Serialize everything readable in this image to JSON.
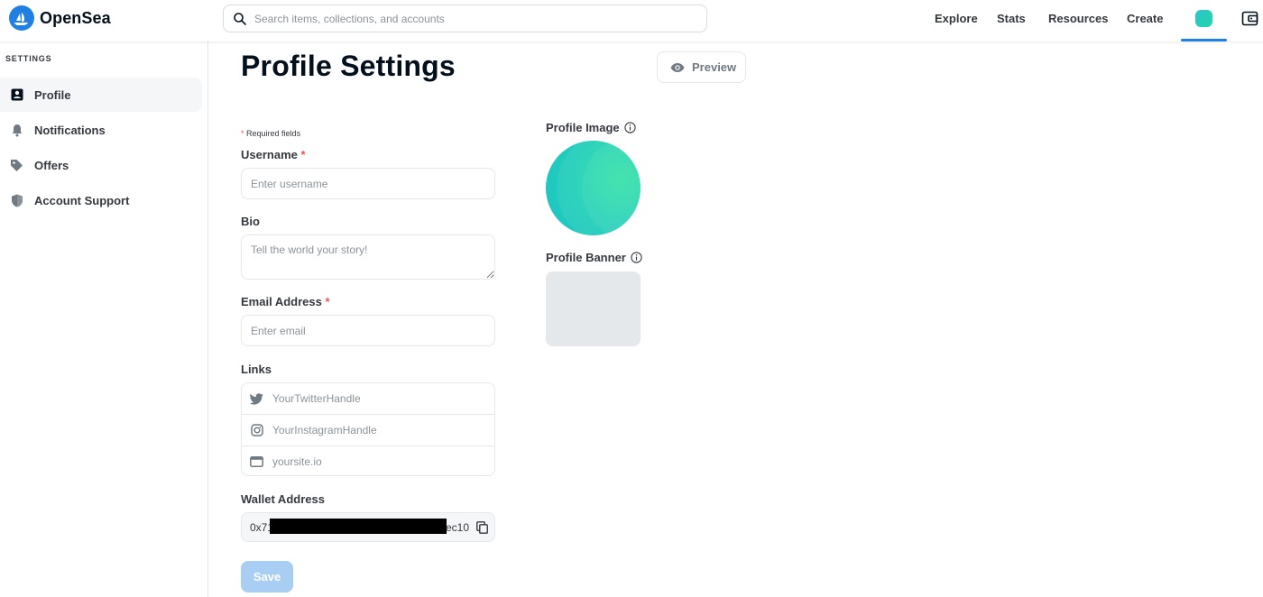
{
  "brand": {
    "name": "OpenSea",
    "logo_icon": "opensea-logo-icon",
    "color": "#2081e2"
  },
  "search": {
    "placeholder": "Search items, collections, and accounts",
    "icon": "search-icon"
  },
  "nav": {
    "links": [
      {
        "label": "Explore"
      },
      {
        "label": "Stats"
      },
      {
        "label": "Resources"
      },
      {
        "label": "Create"
      }
    ],
    "profile_icon": "user-avatar-icon",
    "wallet_icon": "wallet-icon"
  },
  "sidebar": {
    "heading": "SETTINGS",
    "items": [
      {
        "label": "Profile",
        "icon": "profile-icon",
        "active": true
      },
      {
        "label": "Notifications",
        "icon": "bell-icon",
        "active": false
      },
      {
        "label": "Offers",
        "icon": "tag-icon",
        "active": false
      },
      {
        "label": "Account Support",
        "icon": "shield-icon",
        "active": false
      }
    ]
  },
  "main": {
    "title": "Profile Settings",
    "preview_label": "Preview",
    "required_note": "Required fields",
    "required_marker": "*",
    "username": {
      "label": "Username",
      "placeholder": "Enter username",
      "value": ""
    },
    "bio": {
      "label": "Bio",
      "placeholder": "Tell the world your story!",
      "value": ""
    },
    "email": {
      "label": "Email Address",
      "placeholder": "Enter email",
      "value": ""
    },
    "links": {
      "label": "Links",
      "items": [
        {
          "icon": "twitter-icon",
          "placeholder": "YourTwitterHandle"
        },
        {
          "icon": "instagram-icon",
          "placeholder": "YourInstagramHandle"
        },
        {
          "icon": "website-icon",
          "placeholder": "yoursite.io"
        }
      ]
    },
    "wallet": {
      "label": "Wallet Address",
      "prefix": "0x71",
      "suffix": "ec10",
      "copy_icon": "copy-icon"
    },
    "save_label": "Save",
    "profile_image_label": "Profile Image",
    "profile_banner_label": "Profile Banner"
  },
  "colors": {
    "accent": "#2081e2",
    "save_disabled": "#a8cef4",
    "required": "#eb5757",
    "avatar_gradient": [
      "#1ec1c8",
      "#2ee1a4"
    ],
    "banner_placeholder": "#e5e8eb"
  }
}
